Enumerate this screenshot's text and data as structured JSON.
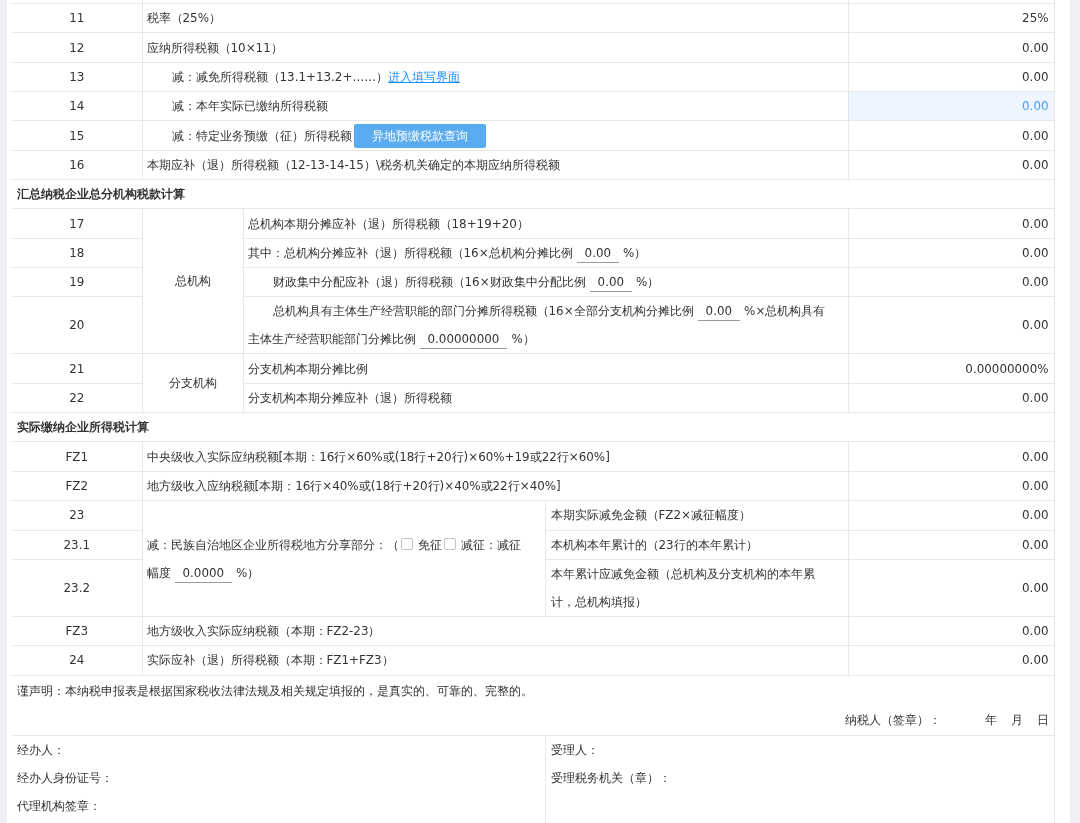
{
  "top_rows": [
    {
      "number": "11",
      "kind": "main",
      "label": [
        {
          "kind": "text",
          "text": "税率（25%）"
        }
      ],
      "value": "25%",
      "editable": false
    },
    {
      "number": "12",
      "kind": "main",
      "label": [
        {
          "kind": "text",
          "text": "应纳所得税额（10×11）"
        }
      ],
      "value": "0.00",
      "editable": false
    },
    {
      "number": "13",
      "kind": "sub",
      "label": [
        {
          "kind": "text",
          "text": "减：减免所得税额（13.1+13.2+……）"
        },
        {
          "kind": "link",
          "text": "进入填写界面"
        }
      ],
      "value": "0.00",
      "editable": false
    },
    {
      "number": "14",
      "kind": "sub",
      "label": [
        {
          "kind": "text",
          "text": "减：本年实际已缴纳所得税额"
        }
      ],
      "value": "0.00",
      "editable": true
    },
    {
      "number": "15",
      "kind": "sub",
      "label": [
        {
          "kind": "text",
          "text": "减：特定业务预缴（征）所得税额"
        },
        {
          "kind": "button",
          "text": "异地预缴税款查询"
        }
      ],
      "value": "0.00",
      "editable": false
    },
    {
      "number": "16",
      "kind": "main",
      "label": [
        {
          "kind": "text",
          "text": "本期应补（退）所得税额（12-13-14-15）\\税务机关确定的本期应纳所得税额"
        }
      ],
      "value": "0.00",
      "editable": false
    }
  ],
  "section_1": {
    "title": "汇总纳税企业总分机构税款计算",
    "groups": [
      {
        "label": "总机构",
        "rows": [
          {
            "number": "17",
            "kind": "main",
            "label": [
              {
                "kind": "text",
                "text": "总机构本期分摊应补（退）所得税额（18+19+20）"
              }
            ],
            "value": "0.00",
            "editable": false
          },
          {
            "number": "18",
            "kind": "main",
            "label": [
              {
                "kind": "text",
                "text": "其中：总机构分摊应补（退）所得税额（16×总机构分摊比例"
              },
              {
                "kind": "input",
                "text": "0.00"
              },
              {
                "kind": "text",
                "text": "%）"
              }
            ],
            "value": "0.00",
            "editable": false
          },
          {
            "number": "19",
            "kind": "sub",
            "label": [
              {
                "kind": "text",
                "text": "财政集中分配应补（退）所得税额（16×财政集中分配比例"
              },
              {
                "kind": "input",
                "text": "0.00"
              },
              {
                "kind": "text",
                "text": "%）"
              }
            ],
            "value": "0.00",
            "editable": false
          },
          {
            "number": "20",
            "kind": "sub",
            "label": [
              {
                "kind": "text",
                "text": "总机构具有主体生产经营职能的部门分摊所得税额（16×全部分支机构分摊比例"
              },
              {
                "kind": "input",
                "text": "0.00"
              },
              {
                "kind": "text",
                "text": "%×总机构具有"
              },
              {
                "kind": "text",
                "text": "主体生产经营职能部门分摊比例"
              },
              {
                "kind": "input",
                "text": "0.00000000"
              },
              {
                "kind": "text",
                "text": "%）"
              }
            ],
            "value": "0.00",
            "editable": false
          }
        ]
      },
      {
        "label": "分支机构",
        "rows": [
          {
            "number": "21",
            "kind": "main",
            "label": [
              {
                "kind": "text",
                "text": "分支机构本期分摊比例"
              }
            ],
            "value": "0.00000000%",
            "editable": false
          },
          {
            "number": "22",
            "kind": "main",
            "label": [
              {
                "kind": "text",
                "text": "分支机构本期分摊应补（退）所得税额"
              }
            ],
            "value": "0.00",
            "editable": false
          }
        ]
      }
    ]
  },
  "section_2": {
    "title": "实际缴纳企业所得税计算",
    "rows_before": [
      {
        "number": "FZ1",
        "kind": "main",
        "label": [
          {
            "kind": "text",
            "text": "中央级收入实际应纳税额[本期：16行×60%或(18行+20行)×60%+19或22行×60%]"
          }
        ],
        "value": "0.00",
        "editable": false
      },
      {
        "number": "FZ2",
        "kind": "main",
        "label": [
          {
            "kind": "text",
            "text": "地方级收入应纳税额[本期：16行×40%或(18行+20行)×40%或22行×40%]"
          }
        ],
        "value": "0.00",
        "editable": false
      }
    ],
    "reduction": {
      "label": [
        {
          "kind": "text",
          "text": "减：民族自治地区企业所得税地方分享部分：（"
        },
        {
          "kind": "checkbox",
          "checked": false
        },
        {
          "kind": "text",
          "text": "免征"
        },
        {
          "kind": "checkbox",
          "checked": false
        },
        {
          "kind": "text",
          "text": "减征：减征"
        },
        {
          "kind": "text",
          "text": "幅度"
        },
        {
          "kind": "input",
          "text": "0.0000"
        },
        {
          "kind": "text",
          "text": "%）"
        }
      ],
      "rows": [
        {
          "number": "23",
          "label": "本期实际减免金额（FZ2×减征幅度）",
          "value": "0.00",
          "editable": false
        },
        {
          "number": "23.1",
          "label": "本机构本年累计的（23行的本年累计）",
          "value": "0.00",
          "editable": false
        },
        {
          "number": "23.2",
          "label": "本年累计应减免金额（总机构及分支机构的本年累计，总机构填报）",
          "value": "0.00",
          "editable": false
        }
      ]
    },
    "rows_after": [
      {
        "number": "FZ3",
        "kind": "main",
        "label": [
          {
            "kind": "text",
            "text": "地方级收入实际应纳税额（本期：FZ2-23）"
          }
        ],
        "value": "0.00",
        "editable": false
      },
      {
        "number": "24",
        "kind": "main",
        "label": [
          {
            "kind": "text",
            "text": "实际应补（退）所得税额（本期：FZ1+FZ3）"
          }
        ],
        "value": "0.00",
        "editable": false
      }
    ]
  },
  "declaration": {
    "statement": "谨声明：本纳税申报表是根据国家税收法律法规及相关规定填报的，是真实的、可靠的、完整的。",
    "signer_label": "纳税人（签章）：",
    "date_labels": [
      "年",
      "月",
      "日"
    ]
  },
  "signatures": {
    "left": [
      "经办人：",
      "经办人身份证号：",
      "代理机构签章："
    ],
    "right": [
      "受理人：",
      "受理税务机关（章）："
    ]
  }
}
